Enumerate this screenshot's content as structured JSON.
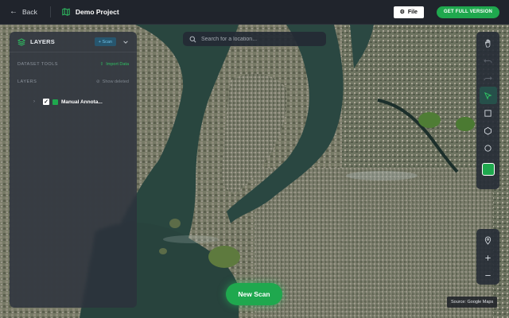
{
  "topbar": {
    "back_label": "Back",
    "project_name": "Demo Project",
    "file_label": "File",
    "full_version_label": "GET FULL VERSION",
    "accent_color": "#1fa84e"
  },
  "layers_panel": {
    "title": "LAYERS",
    "scan_chip_label": "+ Scan",
    "dataset_tools_label": "DATASET TOOLS",
    "import_label": "Import Data",
    "layers_label": "LAYERS",
    "show_deleted_label": "Show deleted",
    "layers": [
      {
        "name": "Manual Annota...",
        "checked": true,
        "color": "#1fa84e"
      }
    ]
  },
  "search": {
    "placeholder": "Search for a location..."
  },
  "toolbar": {
    "tools": [
      "hand-icon",
      "undo-icon",
      "redo-icon",
      "select-pointer-icon",
      "rectangle-icon",
      "polygon-icon",
      "circle-icon"
    ],
    "active_tool": "select-pointer-icon",
    "current_color": "#1fa84e"
  },
  "map_controls": [
    "location-pin-icon",
    "zoom-in-icon",
    "zoom-out-icon"
  ],
  "new_scan_label": "New Scan",
  "source_label": "Source: Google Maps"
}
